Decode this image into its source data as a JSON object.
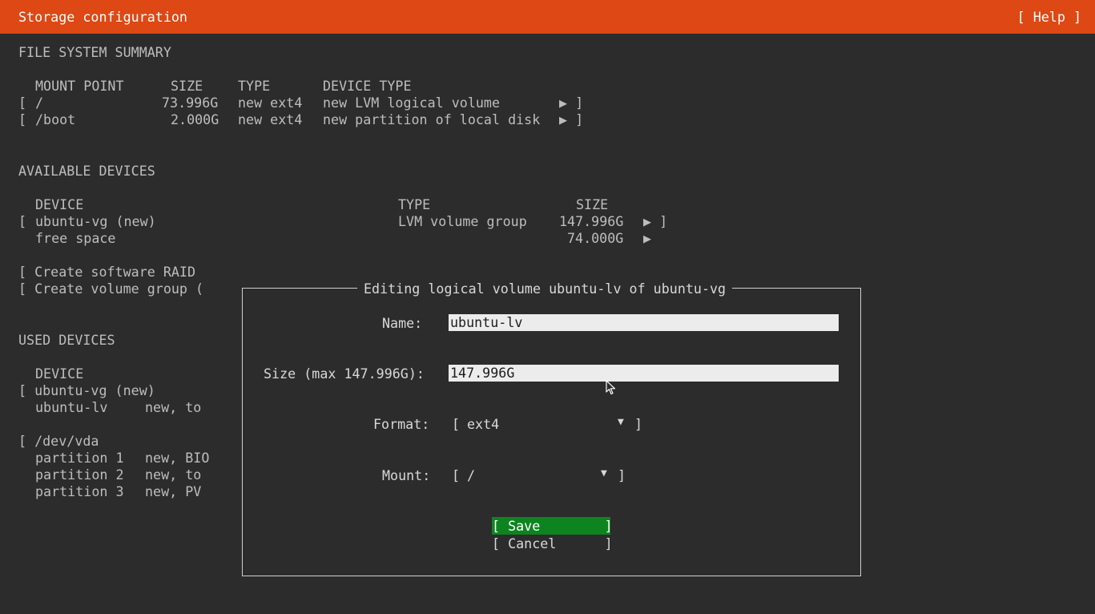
{
  "header": {
    "title": "Storage configuration",
    "help": "[ Help ]"
  },
  "fs_summary": {
    "heading": "FILE SYSTEM SUMMARY",
    "col_mount": "MOUNT POINT",
    "col_size": "SIZE",
    "col_type": "TYPE",
    "col_devtype": "DEVICE TYPE",
    "rows": [
      {
        "open": "[",
        "mount": "/",
        "size": "73.996G",
        "type": "new ext4",
        "devtype": "new LVM logical volume",
        "arrow": "▶ ]"
      },
      {
        "open": "[",
        "mount": "/boot",
        "size": "2.000G",
        "type": "new ext4",
        "devtype": "new partition of local disk",
        "arrow": "▶ ]"
      }
    ]
  },
  "available": {
    "heading": "AVAILABLE DEVICES",
    "col_device": "DEVICE",
    "col_type": "TYPE",
    "col_size": "SIZE",
    "vg_open": "[",
    "vg_name": "ubuntu-vg (new)",
    "vg_type": "LVM volume group",
    "vg_size": "147.996G",
    "vg_arrow": "▶ ]",
    "free_label": "free space",
    "free_size": "74.000G",
    "free_arrow": "▶",
    "create_raid": "[ Create software RAID",
    "create_vg": "[ Create volume group ("
  },
  "used": {
    "heading": "USED DEVICES",
    "col_device": "DEVICE",
    "vg_line": "[ ubuntu-vg (new)",
    "lv_name": "ubuntu-lv",
    "lv_info": "new, to",
    "disk_line": "[ /dev/vda",
    "partitions": [
      {
        "name": "partition 1",
        "info": "new, BIO"
      },
      {
        "name": "partition 2",
        "info": "new, to"
      },
      {
        "name": "partition 3",
        "info": "new, PV"
      }
    ]
  },
  "dialog": {
    "title": "Editing logical volume ubuntu-lv of ubuntu-vg",
    "name_label": "Name:",
    "name_value": "ubuntu-lv",
    "size_label": "Size (max 147.996G):",
    "size_value": "147.996G",
    "format_label": "Format:",
    "format_open": "[",
    "format_value": "ext4",
    "format_arrow": "▼",
    "format_close": "]",
    "mount_label": "Mount:",
    "mount_open": "[",
    "mount_value": "/",
    "mount_arrow": "▼",
    "mount_close": "]",
    "save_label": "[ Save        ]",
    "cancel_label": "[ Cancel      ]"
  },
  "icons": {
    "cursor": "mouse-pointer-icon"
  },
  "colors": {
    "header_bg": "#dd4814",
    "bg": "#2c2c2c",
    "save_bg": "#0e8420"
  }
}
